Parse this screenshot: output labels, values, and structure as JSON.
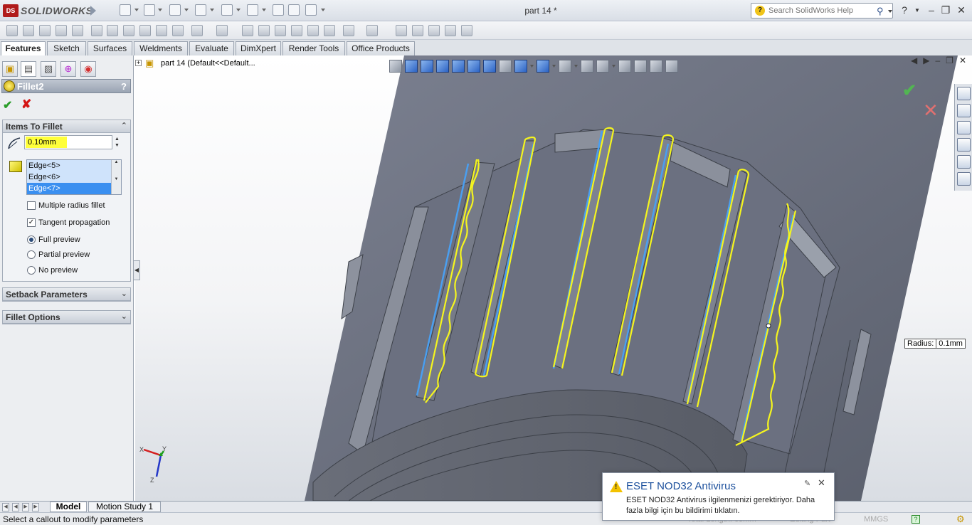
{
  "app": {
    "name": "SOLIDWORKS",
    "document_title": "part 14 *"
  },
  "search": {
    "placeholder": "Search SolidWorks Help"
  },
  "tabs": [
    {
      "label": "Features",
      "active": true
    },
    {
      "label": "Sketch"
    },
    {
      "label": "Surfaces"
    },
    {
      "label": "Weldments"
    },
    {
      "label": "Evaluate"
    },
    {
      "label": "DimXpert"
    },
    {
      "label": "Render Tools"
    },
    {
      "label": "Office Products"
    }
  ],
  "property_manager": {
    "title": "Fillet2",
    "help": "?",
    "items_to_fillet": {
      "heading": "Items To Fillet",
      "radius": "0.10mm",
      "edges": [
        "Edge<5>",
        "Edge<6>",
        "Edge<7>"
      ],
      "selected_edge": "Edge<7>",
      "multiple_radius": {
        "label": "Multiple radius fillet",
        "checked": false
      },
      "tangent_propagation": {
        "label": "Tangent propagation",
        "checked": true
      },
      "preview_options": [
        {
          "label": "Full preview",
          "selected": true
        },
        {
          "label": "Partial preview",
          "selected": false
        },
        {
          "label": "No preview",
          "selected": false
        }
      ]
    },
    "setback": {
      "heading": "Setback Parameters"
    },
    "fillet_options": {
      "heading": "Fillet Options"
    }
  },
  "feature_tree": {
    "root_label": "part 14  (Default<<Default..."
  },
  "callout": {
    "label": "Radius:",
    "value": "0.1mm"
  },
  "bottom_tabs": [
    {
      "label": "Model",
      "active": true
    },
    {
      "label": "Motion Study 1"
    }
  ],
  "status": {
    "message": "Select a callout to modify parameters",
    "total_length": "Total Length: 65mm",
    "mode": "Editing Part",
    "units": "MMGS"
  },
  "triad": {
    "x": "X",
    "y": "Y",
    "z": "Z"
  },
  "notification": {
    "title": "ESET NOD32 Antivirus",
    "body": "ESET NOD32 Antivirus ilgilenmenizi gerektiriyor. Daha fazla bilgi için bu bildirimi tıklatın."
  },
  "colors": {
    "model_face": "#5f6470",
    "selected_edge": "#f5f51e",
    "highlight_edge": "#4a9ff0",
    "accent": "#1b4f9c"
  }
}
